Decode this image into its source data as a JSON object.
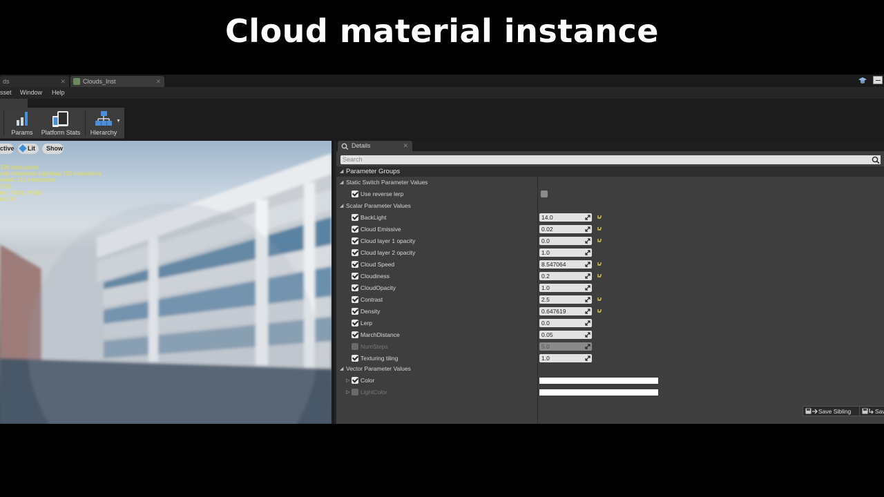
{
  "slide": {
    "title": "Cloud material instance"
  },
  "tabs": [
    {
      "label": "ds"
    },
    {
      "label": "Clouds_Inst"
    }
  ],
  "menu": {
    "items": [
      "sset",
      "Window",
      "Help"
    ]
  },
  "toolbar": {
    "params": "Params",
    "platform_stats": "Platform Stats",
    "hierarchy": "Hierarchy"
  },
  "viewport": {
    "btn_left": "ctive",
    "btn_lit": "Lit",
    "btn_show": "Show",
    "stats": [
      "199 instructions",
      "with Volumetric Lightmap 226 instructions",
      "nader: 111 instructions",
      "7/16",
      "et) : VS(0), PS(6)",
      "ed: 33"
    ]
  },
  "details": {
    "tab_label": "Details",
    "search_placeholder": "Search",
    "parameter_groups": "Parameter Groups",
    "static_switch": {
      "header": "Static Switch Parameter Values",
      "items": [
        {
          "label": "Use reverse lerp",
          "checked": true
        }
      ]
    },
    "scalar": {
      "header": "Scalar Parameter Values",
      "items": [
        {
          "label": "BackLight",
          "value": "14.0",
          "enabled": true,
          "reset": true
        },
        {
          "label": "Cloud Emissive",
          "value": "0.02",
          "enabled": true,
          "reset": true
        },
        {
          "label": "Cloud layer 1 opacity",
          "value": "0.0",
          "enabled": true,
          "reset": true
        },
        {
          "label": "Cloud layer 2 opacity",
          "value": "1.0",
          "enabled": true,
          "reset": false
        },
        {
          "label": "Cloud Speed",
          "value": "8.547064",
          "enabled": true,
          "reset": true
        },
        {
          "label": "Cloudiness",
          "value": "0.2",
          "enabled": true,
          "reset": true
        },
        {
          "label": "CloudOpacity",
          "value": "1.0",
          "enabled": true,
          "reset": false
        },
        {
          "label": "Contrast",
          "value": "2.5",
          "enabled": true,
          "reset": true
        },
        {
          "label": "Density",
          "value": "0.647619",
          "enabled": true,
          "reset": true
        },
        {
          "label": "Lerp",
          "value": "0.0",
          "enabled": true,
          "reset": false
        },
        {
          "label": "MarchDistance",
          "value": "0.05",
          "enabled": true,
          "reset": false
        },
        {
          "label": "NumSteps",
          "value": "5.0",
          "enabled": false,
          "reset": false
        },
        {
          "label": "Texturing tiling",
          "value": "1.0",
          "enabled": true,
          "reset": false
        }
      ]
    },
    "vector": {
      "header": "Vector Parameter Values",
      "items": [
        {
          "label": "Color",
          "enabled": true,
          "color": "#ffffff"
        },
        {
          "label": "LightColor",
          "enabled": false,
          "color": "#ffffff"
        }
      ]
    },
    "save_sibling": "Save Sibling",
    "save_other": "Sav"
  },
  "colors": {
    "accent_blue": "#3b8fd9",
    "stats_yellow": "#e6e14a",
    "reset_arrow": "#d8c84a"
  }
}
